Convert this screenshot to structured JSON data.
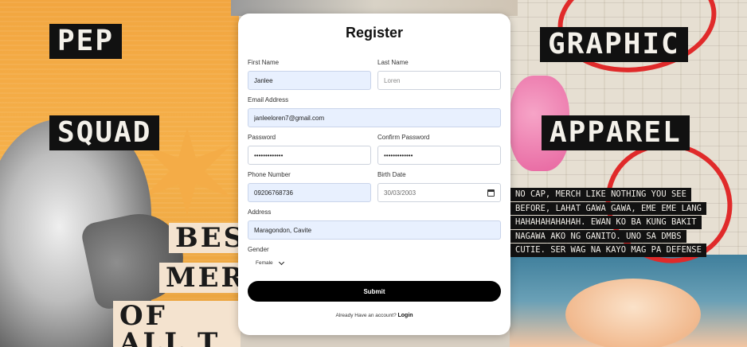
{
  "background": {
    "labels": {
      "pep": "PEP",
      "squad": "SQUAD",
      "graphic": "GRAPHIC",
      "apparel": "APPAREL",
      "best_line1": "BES",
      "best_line2": "MERC",
      "best_line3": "OF ALL T"
    },
    "paragraph_lines": [
      "NO CAP, MERCH LIKE NOTHING YOU SEE",
      "BEFORE, LAHAT GAWA GAWA, EME EME LANG",
      "HAHAHAHAHAHAH. EWAN KO BA KUNG BAKIT",
      "NAGAWA AKO NG GANITO. UNO SA DMBS",
      "CUTIE. SER WAG NA KAYO MAG PA DEFENSE"
    ],
    "accent_red": "#e02a2a",
    "accent_orange": "#f2a640"
  },
  "form": {
    "title": "Register",
    "first_name": {
      "label": "First Name",
      "value": "Janlee"
    },
    "last_name": {
      "label": "Last Name",
      "placeholder": "Loren"
    },
    "email": {
      "label": "Email Address",
      "value": "janleeloren7@gmail.com"
    },
    "password": {
      "label": "Password",
      "value": "•••••••••••••"
    },
    "confirm_password": {
      "label": "Confirm Password",
      "value": "•••••••••••••"
    },
    "phone": {
      "label": "Phone Number",
      "value": "09206768736"
    },
    "birth_date": {
      "label": "Birth Date",
      "value": "30/03/2003"
    },
    "address": {
      "label": "Address",
      "value": "Maragondon, Cavite"
    },
    "gender": {
      "label": "Gender",
      "selected": "Female"
    },
    "submit_label": "Submit",
    "footer_text": "Already Have an account?",
    "login_link": "Login"
  }
}
